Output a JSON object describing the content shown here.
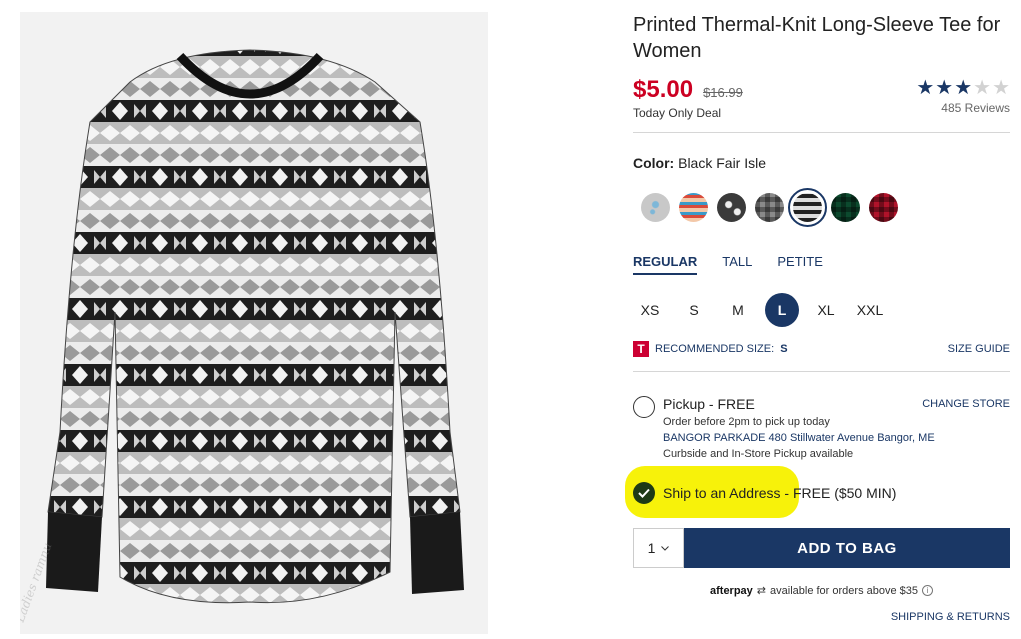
{
  "product": {
    "title": "Printed Thermal-Knit Long-Sleeve Tee for Women",
    "sale_price": "$5.00",
    "original_price": "$16.99",
    "deal_label": "Today Only Deal",
    "rating_stars": 3,
    "rating_max": 5,
    "review_count": "485 Reviews",
    "image_watermark": "Ladies ramnu"
  },
  "color": {
    "label": "Color:",
    "value": "Black Fair Isle",
    "swatches": [
      {
        "name": "light-grey-print",
        "color": "#c8c8c8"
      },
      {
        "name": "multicolor-fair-isle",
        "color": "#e8845a"
      },
      {
        "name": "black-white-print",
        "color": "#3a3a3a"
      },
      {
        "name": "grey-plaid",
        "color": "#8a8a8a"
      },
      {
        "name": "black-fair-isle",
        "color": "#6e6e6e",
        "selected": true
      },
      {
        "name": "green-plaid",
        "color": "#0c4a2e"
      },
      {
        "name": "red-buffalo-plaid",
        "color": "#b0122a"
      }
    ]
  },
  "fit_tabs": [
    "REGULAR",
    "TALL",
    "PETITE"
  ],
  "sizes": [
    "XS",
    "S",
    "M",
    "L",
    "XL",
    "XXL"
  ],
  "selected_size": "L",
  "recommended": {
    "badge": "T",
    "label": "RECOMMENDED SIZE:",
    "value": "S",
    "size_guide": "SIZE GUIDE"
  },
  "pickup": {
    "title": "Pickup - FREE",
    "change_store": "CHANGE STORE",
    "order_by": "Order before 2pm to pick up today",
    "address": "BANGOR PARKADE 480 Stillwater Avenue  Bangor, ME",
    "availability": "Curbside and In-Store Pickup available"
  },
  "ship": {
    "label": "Ship to an Address",
    "suffix": " - FREE ($50 MIN)"
  },
  "bag": {
    "quantity": "1",
    "add_label": "ADD TO BAG"
  },
  "afterpay": {
    "logo": "afterpay",
    "text": "available for orders above $35",
    "info": "i"
  },
  "shipping_returns": "SHIPPING & RETURNS",
  "colors": {
    "navy": "#1a3765",
    "sale_red": "#cc0022",
    "highlight_yellow": "#f7f20a"
  }
}
